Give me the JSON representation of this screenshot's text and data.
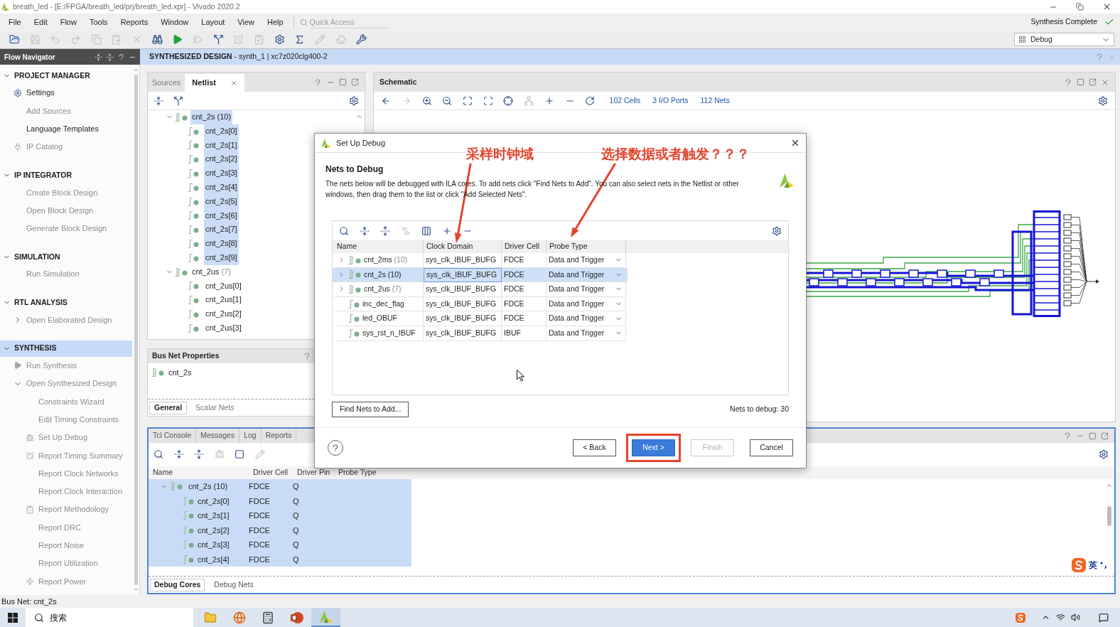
{
  "window": {
    "title": "breath_led - [E:/FPGA/breath_led/prj/breath_led.xpr] - Vivado 2020.2"
  },
  "menu": [
    "File",
    "Edit",
    "Flow",
    "Tools",
    "Reports",
    "Window",
    "Layout",
    "View",
    "Help"
  ],
  "quick_access": {
    "placeholder": "Quick Access"
  },
  "run_status": "Synthesis Complete",
  "toolbar": [
    {
      "disabled": false
    },
    {
      "disabled": true
    },
    {
      "disabled": true
    },
    {
      "disabled": true
    },
    {
      "disabled": true
    },
    {
      "disabled": true
    },
    {
      "disabled": true
    },
    {
      "disabled": false
    },
    {
      "disabled": false
    },
    {
      "disabled": true
    },
    {
      "disabled": false
    },
    {
      "disabled": true
    },
    {
      "disabled": true
    },
    {
      "disabled": false
    },
    {
      "disabled": false
    },
    {
      "disabled": true
    },
    {
      "disabled": true
    },
    {
      "disabled": false
    }
  ],
  "layout_selector": {
    "value": "Debug"
  },
  "design_header": "**SYNTHESIZED DESIGN** - synth_1 | xc7z020clg400-2",
  "flow_navigator": {
    "title": "Flow Navigator",
    "sections": [
      {
        "label": "PROJECT MANAGER",
        "expanded": true,
        "selected": false,
        "items": [
          {
            "label": "Settings",
            "disabled": false
          },
          {
            "label": "Add Sources",
            "disabled": true
          },
          {
            "label": "Language Templates",
            "disabled": false
          },
          {
            "label": "IP Catalog",
            "disabled": true
          }
        ]
      },
      {
        "label": "IP INTEGRATOR",
        "expanded": true,
        "selected": false,
        "items": [
          {
            "label": "Create Block Design",
            "disabled": true
          },
          {
            "label": "Open Block Design",
            "disabled": true
          },
          {
            "label": "Generate Block Design",
            "disabled": true
          }
        ]
      },
      {
        "label": "SIMULATION",
        "expanded": true,
        "selected": false,
        "items": [
          {
            "label": "Run Simulation",
            "disabled": true
          }
        ]
      },
      {
        "label": "RTL ANALYSIS",
        "expanded": true,
        "selected": false,
        "items": [
          {
            "label": "Open Elaborated Design",
            "disabled": true,
            "expanded": false
          }
        ]
      },
      {
        "label": "SYNTHESIS",
        "expanded": true,
        "selected": true,
        "items": [
          {
            "label": "Run Synthesis",
            "disabled": true
          },
          {
            "label": "Open Synthesized Design",
            "disabled": true,
            "expanded": true,
            "children": [
              {
                "label": "Constraints Wizard",
                "disabled": true
              },
              {
                "label": "Edit Timing Constraints",
                "disabled": true
              },
              {
                "label": "Set Up Debug",
                "disabled": true
              },
              {
                "label": "Report Timing Summary",
                "disabled": true
              },
              {
                "label": "Report Clock Networks",
                "disabled": true
              },
              {
                "label": "Report Clock Interaction",
                "disabled": true
              },
              {
                "label": "Report Methodology",
                "disabled": true
              },
              {
                "label": "Report DRC",
                "disabled": true
              },
              {
                "label": "Report Noise",
                "disabled": true
              },
              {
                "label": "Report Utilization",
                "disabled": true
              },
              {
                "label": "Report Power",
                "disabled": true
              }
            ]
          }
        ]
      }
    ]
  },
  "netlist": {
    "tabs": [
      {
        "label": "Sources",
        "selected": false
      },
      {
        "label": "Netlist",
        "selected": true
      }
    ],
    "tree": [
      {
        "label": "cnt_2s",
        "count": "(10)",
        "expanded": true,
        "selected": true,
        "children": [
          {
            "label": "cnt_2s[0]",
            "selected": true
          },
          {
            "label": "cnt_2s[1]",
            "selected": true
          },
          {
            "label": "cnt_2s[2]",
            "selected": true
          },
          {
            "label": "cnt_2s[3]",
            "selected": true
          },
          {
            "label": "cnt_2s[4]",
            "selected": true
          },
          {
            "label": "cnt_2s[5]",
            "selected": true
          },
          {
            "label": "cnt_2s[6]",
            "selected": true
          },
          {
            "label": "cnt_2s[7]",
            "selected": true
          },
          {
            "label": "cnt_2s[8]",
            "selected": true
          },
          {
            "label": "cnt_2s[9]",
            "selected": true
          }
        ]
      },
      {
        "label": "cnt_2us",
        "count": "(7)",
        "expanded": true,
        "selected": false,
        "children": [
          {
            "label": "cnt_2us[0]",
            "selected": false
          },
          {
            "label": "cnt_2us[1]",
            "selected": false
          },
          {
            "label": "cnt_2us[2]",
            "selected": false
          },
          {
            "label": "cnt_2us[3]",
            "selected": false
          }
        ]
      }
    ]
  },
  "bus_net_properties": {
    "title": "Bus Net Properties",
    "net": "cnt_2s",
    "tabs": [
      {
        "label": "General",
        "selected": true
      },
      {
        "label": "Scalar Nets",
        "selected": false
      }
    ]
  },
  "schematic": {
    "title": "Schematic",
    "toolbar": [
      {
        "disabled": false
      },
      {
        "disabled": true
      },
      {
        "disabled": false
      },
      {
        "disabled": false
      },
      {
        "disabled": false
      },
      {
        "disabled": false
      },
      {
        "disabled": false
      },
      {
        "disabled": true
      },
      {
        "disabled": false
      },
      {
        "disabled": false
      },
      {
        "disabled": false
      }
    ],
    "links": [
      "102 Cells",
      "3 I/O Ports",
      "112 Nets"
    ]
  },
  "debug_panel": {
    "tabs": [
      {
        "label": "Tcl Console",
        "selected": false
      },
      {
        "label": "Messages",
        "selected": false
      },
      {
        "label": "Log",
        "selected": false
      },
      {
        "label": "Reports",
        "selected": false
      }
    ],
    "toolbar": [
      {
        "disabled": false
      },
      {
        "disabled": false
      },
      {
        "disabled": false
      },
      {
        "disabled": true
      },
      {
        "disabled": false
      },
      {
        "disabled": true
      }
    ],
    "columns": [
      "Name",
      "Driver Cell",
      "Driver Pin",
      "Probe Type"
    ],
    "rows": [
      {
        "name": "cnt_2s",
        "count": "(10)",
        "driver_cell": "FDCE",
        "driver_pin": "Q",
        "expanded": true,
        "selected": true,
        "children": [
          {
            "name": "cnt_2s[0]",
            "driver_cell": "FDCE",
            "driver_pin": "Q",
            "selected": true
          },
          {
            "name": "cnt_2s[1]",
            "driver_cell": "FDCE",
            "driver_pin": "Q",
            "selected": true
          },
          {
            "name": "cnt_2s[2]",
            "driver_cell": "FDCE",
            "driver_pin": "Q",
            "selected": true
          },
          {
            "name": "cnt_2s[3]",
            "driver_cell": "FDCE",
            "driver_pin": "Q",
            "selected": true
          },
          {
            "name": "cnt_2s[4]",
            "driver_cell": "FDCE",
            "driver_pin": "Q",
            "selected": true
          }
        ]
      }
    ],
    "bottom_tabs": [
      {
        "label": "Debug Cores",
        "selected": true
      },
      {
        "label": "Debug Nets",
        "selected": false
      }
    ]
  },
  "status_bar": "Bus Net: cnt_2s",
  "dialog": {
    "title": "Set Up Debug",
    "heading": "Nets to Debug",
    "description": "The nets below will be debugged with ILA cores. To add nets click \"Find Nets to Add\". You can also select nets in the Netlist or other windows, then drag them to the list or click \"Add Selected Nets\".",
    "toolbar": [
      {
        "disabled": false
      },
      {
        "disabled": false
      },
      {
        "disabled": false
      },
      {
        "disabled": true
      },
      {
        "disabled": false
      },
      {
        "disabled": false
      },
      {
        "disabled": false
      }
    ],
    "columns": [
      "Name",
      "Clock Domain",
      "Driver Cell",
      "Probe Type"
    ],
    "rows": [
      {
        "kind": "bus",
        "name": "cnt_2ms",
        "count": "(10)",
        "expanded": false,
        "clock_domain": "sys_clk_IBUF_BUFG",
        "driver_cell": "FDCE",
        "probe_type": "Data and Trigger",
        "selected": false
      },
      {
        "kind": "bus",
        "name": "cnt_2s",
        "count": "(10)",
        "expanded": false,
        "clock_domain": "sys_clk_IBUF_BUFG",
        "driver_cell": "FDCE",
        "probe_type": "Data and Trigger",
        "selected": true
      },
      {
        "kind": "bus",
        "name": "cnt_2us",
        "count": "(7)",
        "expanded": false,
        "clock_domain": "sys_clk_IBUF_BUFG",
        "driver_cell": "FDCE",
        "probe_type": "Data and Trigger",
        "selected": false
      },
      {
        "kind": "net",
        "name": "inc_dec_flag",
        "clock_domain": "sys_clk_IBUF_BUFG",
        "driver_cell": "FDCE",
        "probe_type": "Data and Trigger",
        "selected": false
      },
      {
        "kind": "net",
        "name": "led_OBUF",
        "clock_domain": "sys_clk_IBUF_BUFG",
        "driver_cell": "FDCE",
        "probe_type": "Data and Trigger",
        "selected": false
      },
      {
        "kind": "net",
        "name": "sys_rst_n_IBUF",
        "clock_domain": "sys_clk_IBUF_BUFG",
        "driver_cell": "IBUF",
        "probe_type": "Data and Trigger",
        "selected": false
      }
    ],
    "find_button": "Find Nets to Add...",
    "summary": "Nets to debug: 30",
    "buttons": [
      {
        "label": "< Back",
        "primary": false,
        "disabled": false,
        "highlighted": false
      },
      {
        "label": "Next >",
        "primary": true,
        "disabled": false,
        "highlighted": true
      },
      {
        "label": "Finish",
        "primary": false,
        "disabled": true,
        "highlighted": false
      },
      {
        "label": "Cancel",
        "primary": false,
        "disabled": false,
        "highlighted": false
      }
    ]
  },
  "annotations": [
    {
      "text": "采样时钟域"
    },
    {
      "text": "选择数据或者触发？？？"
    }
  ],
  "taskbar": {
    "search_placeholder": "搜索",
    "apps": [
      {
        "selected": false
      },
      {
        "selected": false
      },
      {
        "selected": false
      },
      {
        "selected": false
      },
      {
        "selected": true
      }
    ]
  },
  "ime": {
    "mode": "英"
  }
}
